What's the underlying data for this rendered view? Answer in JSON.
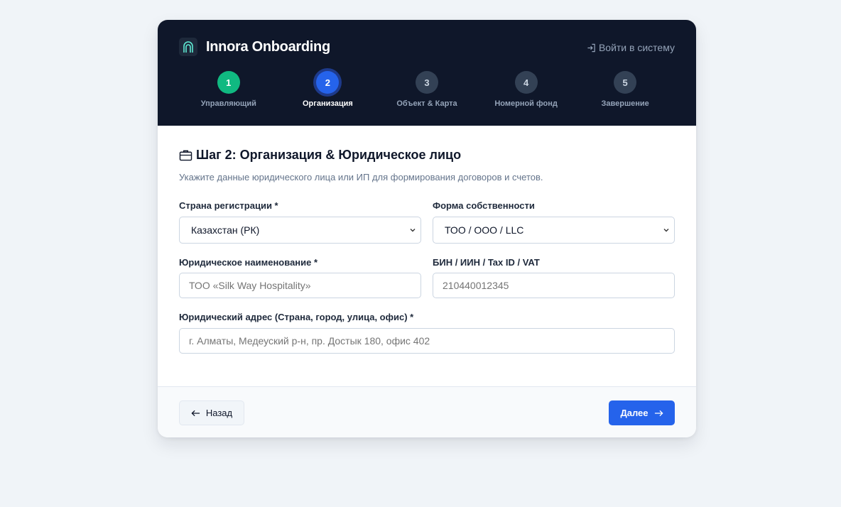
{
  "header": {
    "brand_name": "Innora Onboarding",
    "login_link": "Войти в систему"
  },
  "steps": [
    {
      "number": "1",
      "label": "Управляющий",
      "state": "done"
    },
    {
      "number": "2",
      "label": "Организация",
      "state": "active"
    },
    {
      "number": "3",
      "label": "Объект & Карта",
      "state": "pending"
    },
    {
      "number": "4",
      "label": "Номерной фонд",
      "state": "pending"
    },
    {
      "number": "5",
      "label": "Завершение",
      "state": "pending"
    }
  ],
  "section": {
    "title": "Шаг 2: Организация & Юридическое лицо",
    "description": "Укажите данные юридического лица или ИП для формирования договоров и счетов."
  },
  "form": {
    "country": {
      "label": "Страна регистрации *",
      "value": "Казахстан (РК)"
    },
    "ownership": {
      "label": "Форма собственности",
      "value": "ТОО / ООО / LLC"
    },
    "legal_name": {
      "label": "Юридическое наименование *",
      "placeholder": "ТОО «Silk Way Hospitality»"
    },
    "tax_id": {
      "label": "БИН / ИИН / Tax ID / VAT",
      "placeholder": "210440012345"
    },
    "address": {
      "label": "Юридический адрес (Страна, город, улица, офис) *",
      "placeholder": "г. Алматы, Медеуский р-н, пр. Достык 180, офис 402"
    }
  },
  "footer": {
    "back_label": "Назад",
    "next_label": "Далее"
  },
  "colors": {
    "header_bg": "#0f172a",
    "accent": "#2563eb",
    "done": "#10b981"
  },
  "icons": [
    "arch-logo-icon",
    "login-icon",
    "briefcase-icon",
    "arrow-left-icon",
    "arrow-right-icon",
    "chevron-down-icon"
  ]
}
